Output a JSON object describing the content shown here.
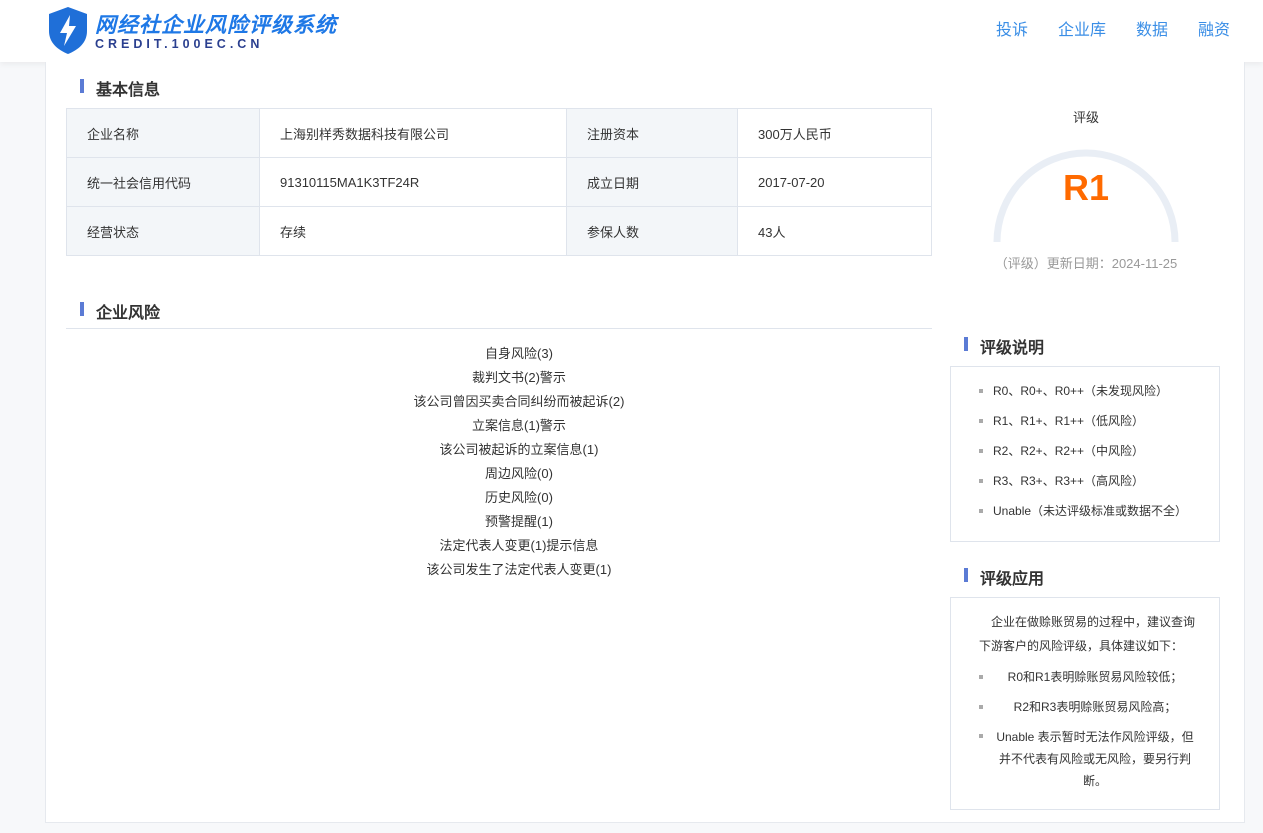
{
  "header": {
    "logo_title": "网经社企业风险评级系统",
    "logo_sub": "CREDIT.100EC.CN",
    "nav": [
      "投诉",
      "企业库",
      "数据",
      "融资"
    ]
  },
  "basic": {
    "title": "基本信息",
    "rows": [
      [
        "企业名称",
        "上海别样秀数据科技有限公司",
        "注册资本",
        "300万人民币"
      ],
      [
        "统一社会信用代码",
        "91310115MA1K3TF24R",
        "成立日期",
        "2017-07-20"
      ],
      [
        "经营状态",
        "存续",
        "参保人数",
        "43人"
      ]
    ]
  },
  "rating": {
    "label": "评级",
    "value": "R1",
    "date": "（评级）更新日期：2024-11-25",
    "color": "#ff6a00"
  },
  "risk": {
    "title": "企业风险",
    "items": [
      "自身风险(3)",
      "裁判文书(2)警示",
      "该公司曾因买卖合同纠纷而被起诉(2)",
      "立案信息(1)警示",
      "该公司被起诉的立案信息(1)",
      "周边风险(0)",
      "历史风险(0)",
      "预警提醒(1)",
      "法定代表人变更(1)提示信息",
      "该公司发生了法定代表人变更(1)"
    ]
  },
  "explain": {
    "title": "评级说明",
    "items": [
      "R0、R0+、R0++（未发现风险）",
      "R1、R1+、R1++（低风险）",
      "R2、R2+、R2++（中风险）",
      "R3、R3+、R3++（高风险）",
      "Unable（未达评级标准或数据不全）"
    ]
  },
  "apply": {
    "title": "评级应用",
    "intro": "企业在做赊账贸易的过程中，建议查询下游客户的风险评级，具体建议如下：",
    "items": [
      "R0和R1表明赊账贸易风险较低；",
      "R2和R3表明赊账贸易风险高；",
      "Unable 表示暂时无法作风险评级，但并不代表有风险或无风险，要另行判断。"
    ]
  }
}
